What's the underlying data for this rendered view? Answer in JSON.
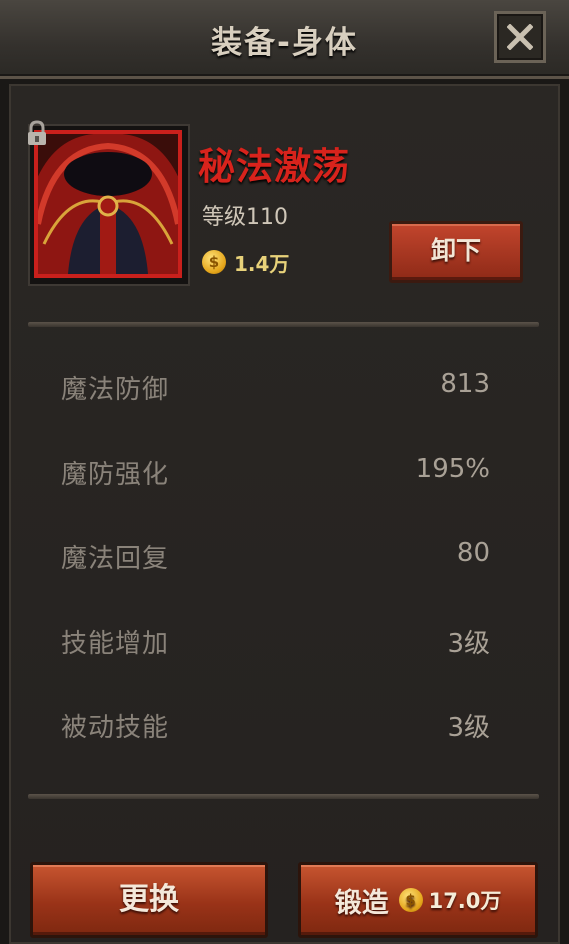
{
  "header": {
    "title": "装备-身体"
  },
  "item": {
    "name": "秘法激荡",
    "level": "等级110",
    "price": "1.4万",
    "coin_symbol": "$",
    "rarity_color": "#c9201c"
  },
  "actions": {
    "unequip_label": "卸下",
    "replace_label": "更换",
    "forge_label": "锻造",
    "forge_cost": "17.0万",
    "coin_symbol": "$"
  },
  "stats": [
    {
      "label": "魔法防御",
      "value": "813"
    },
    {
      "label": "魔防强化",
      "value": "195%"
    },
    {
      "label": "魔法回复",
      "value": "80"
    },
    {
      "label": "技能增加",
      "value": "3级"
    },
    {
      "label": "被动技能",
      "value": "3级"
    }
  ],
  "icons": {
    "close": "close-icon",
    "lock": "lock-icon",
    "coin": "coin-icon"
  }
}
